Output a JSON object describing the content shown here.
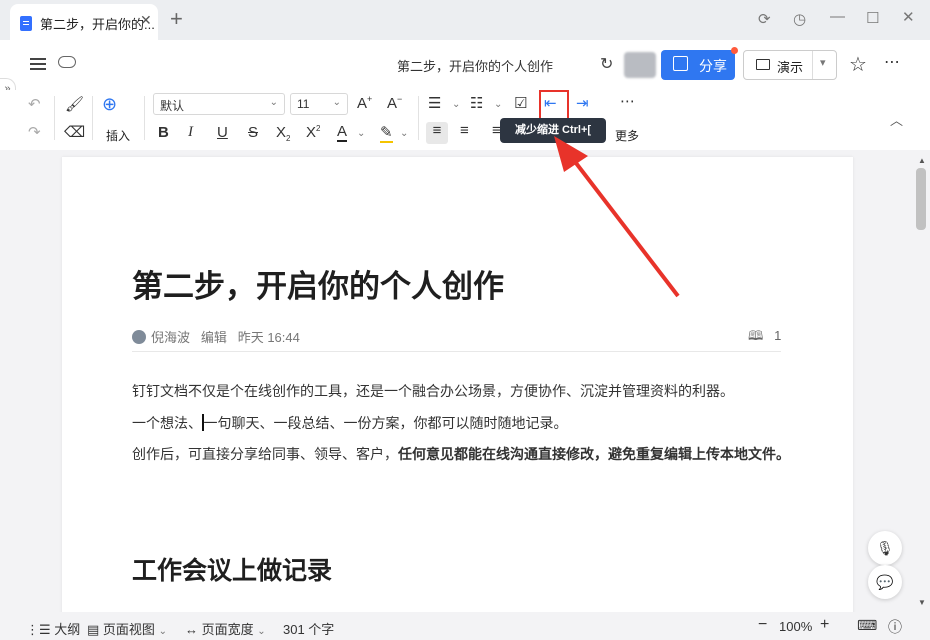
{
  "tabbar": {
    "tab_title": "第二步，开启你的...",
    "close": "✕",
    "new_tab": "+"
  },
  "header": {
    "doc_title": "第二步，开启你的个人创作",
    "share_label": "分享",
    "present_label": "演示",
    "more": "⋯"
  },
  "toolbar": {
    "insert_label": "插入",
    "font_name": "默认",
    "font_size": "11",
    "more_label": "更多",
    "tooltip": "减少缩进 Ctrl+["
  },
  "document": {
    "title": "第二步，开启你的个人创作",
    "author": "倪海波",
    "edit_label": "编辑",
    "edit_time": "昨天 16:44",
    "comment_count": "1",
    "para1": "钉钉文档不仅是个在线创作的工具，还是一个融合办公场景，方便协作、沉淀并管理资料的利器。",
    "para2_a": "一个想法、",
    "para2_b": "一句聊天、一段总结、一份方案，你都可以随时随地记录。",
    "para3_a": "创作后，可直接分享给同事、领导、客户，",
    "para3_b": "任何意见都能在线沟通直接修改，避免重复编辑上传本地文件。",
    "heading2": "工作会议上做记录"
  },
  "statusbar": {
    "outline": "大纲",
    "page_view": "页面视图",
    "page_width": "页面宽度",
    "word_count": "301 个字",
    "zoom": "100%"
  },
  "colors": {
    "accent": "#2f77f1",
    "highlight_box": "#e8332a",
    "arrow": "#e8332a"
  }
}
